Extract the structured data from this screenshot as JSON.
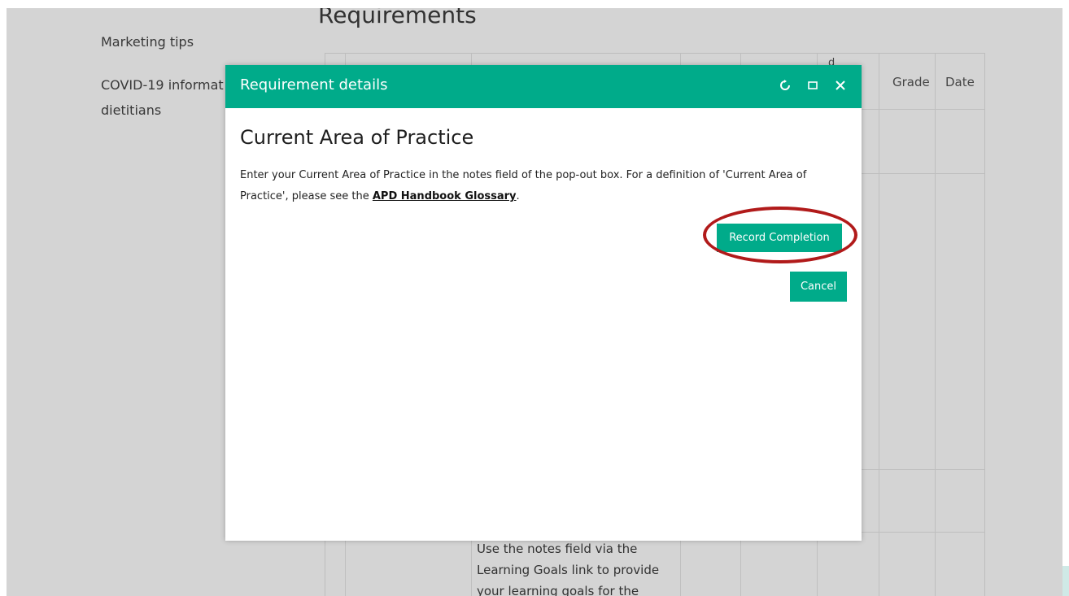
{
  "background": {
    "sidebar": {
      "items": [
        "Marketing tips",
        "COVID-19 informat",
        "dietitians"
      ]
    },
    "requirements_title": "Requirements",
    "table": {
      "header_fragment": "d",
      "headers": [
        "Grade",
        "Date"
      ],
      "note_text": "Use the notes field via the Learning Goals link to provide your learning goals for the year."
    }
  },
  "modal": {
    "title": "Requirement details",
    "icons": {
      "refresh": "refresh-icon",
      "maximize": "maximize-icon",
      "close": "close-icon"
    },
    "heading": "Current Area of Practice",
    "text_before_link": "Enter your Current Area of Practice in the notes field of the pop-out box. For a definition of 'Current Area of Practice', please see the ",
    "link_text": "APD Handbook Glossary",
    "text_after_link": ".",
    "record_button": "Record Completion",
    "cancel_button": "Cancel"
  },
  "colors": {
    "accent": "#00ab8a",
    "highlight": "#b11a1a"
  }
}
